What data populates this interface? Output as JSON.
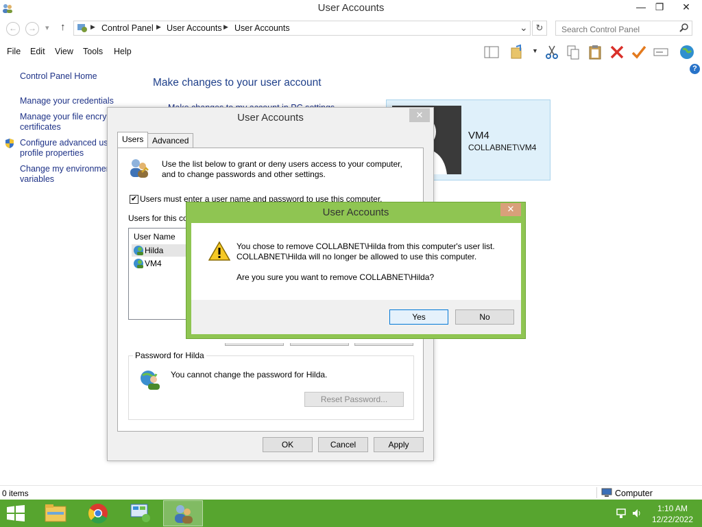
{
  "window": {
    "title": "User Accounts",
    "minimize": "—",
    "restore": "❐",
    "close": "✕"
  },
  "nav": {
    "back": "←",
    "forward": "→",
    "dropdown": "▾",
    "up": "↑",
    "breadcrumbs": [
      "Control Panel",
      "User Accounts",
      "User Accounts"
    ],
    "address_dropdown": "⌄",
    "refresh": "↻",
    "search_placeholder": "Search Control Panel"
  },
  "menu": [
    "File",
    "Edit",
    "View",
    "Tools",
    "Help"
  ],
  "left_pane": {
    "home": "Control Panel Home",
    "links": [
      "Manage your credentials",
      "Manage your file encryp",
      "certificates",
      "Configure advanced use",
      "profile properties",
      "Change my environmen",
      "variables"
    ]
  },
  "main": {
    "heading": "Make changes to your user account",
    "partial_link": "Make changes to my account in PC settings",
    "account": {
      "name": "VM4",
      "domain": "COLLABNET\\VM4"
    },
    "help": "?"
  },
  "status": {
    "items": "0 items",
    "location": "Computer"
  },
  "dialog": {
    "title": "User Accounts",
    "close": "✕",
    "tabs": [
      "Users",
      "Advanced"
    ],
    "intro_line1": "Use the list below to grant or deny users access to your computer,",
    "intro_line2": "and to change passwords and other settings.",
    "checkbox_label": "Users must enter a user name and password to use this computer.",
    "checkbox_mark": "✔",
    "users_label": "Users for this co",
    "list_header": "User Name",
    "users": [
      "Hilda",
      "VM4"
    ],
    "password_group": "Password for Hilda",
    "password_text": "You cannot change the password for Hilda.",
    "reset_button": "Reset Password...",
    "ok": "OK",
    "cancel": "Cancel",
    "apply": "Apply"
  },
  "confirm": {
    "title": "User Accounts",
    "close": "✕",
    "line1": "You chose to remove COLLABNET\\Hilda from this computer's user list.",
    "line2": "COLLABNET\\Hilda will no longer be allowed to use this computer.",
    "question": "Are you sure you want to remove COLLABNET\\Hilda?",
    "yes": "Yes",
    "no": "No"
  },
  "taskbar": {
    "time": "1:10 AM",
    "date": "12/22/2022",
    "color": "#57a52f"
  }
}
